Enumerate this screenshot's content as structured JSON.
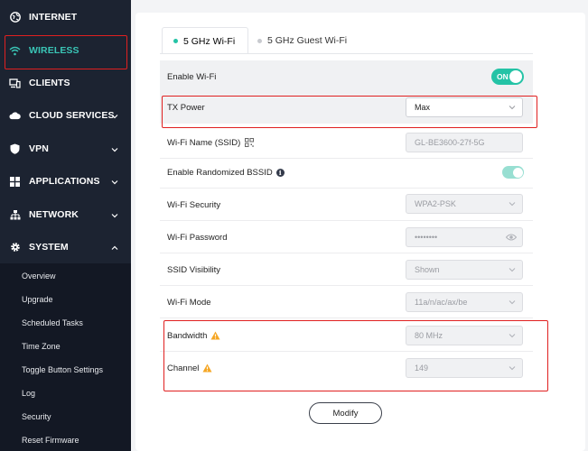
{
  "sidebar": {
    "items": [
      {
        "label": "INTERNET",
        "icon": "globe-icon"
      },
      {
        "label": "WIRELESS",
        "icon": "wifi-icon"
      },
      {
        "label": "CLIENTS",
        "icon": "devices-icon"
      },
      {
        "label": "CLOUD SERVICES",
        "icon": "cloud-icon"
      },
      {
        "label": "VPN",
        "icon": "shield-icon"
      },
      {
        "label": "APPLICATIONS",
        "icon": "grid-icon"
      },
      {
        "label": "NETWORK",
        "icon": "network-icon"
      },
      {
        "label": "SYSTEM",
        "icon": "gear-icon"
      }
    ],
    "system_submenu": [
      "Overview",
      "Upgrade",
      "Scheduled Tasks",
      "Time Zone",
      "Toggle Button Settings",
      "Log",
      "Security",
      "Reset Firmware"
    ]
  },
  "tabs": [
    {
      "label": "5 GHz Wi-Fi",
      "active": true
    },
    {
      "label": "5 GHz Guest Wi-Fi",
      "active": false
    }
  ],
  "settings": {
    "enable_wifi": {
      "label": "Enable Wi-Fi",
      "toggle": "ON"
    },
    "tx_power": {
      "label": "TX Power",
      "value": "Max"
    },
    "ssid": {
      "label": "Wi-Fi Name (SSID)",
      "value": "GL-BE3600-27f-5G"
    },
    "randomized_bssid": {
      "label": "Enable Randomized BSSID"
    },
    "security": {
      "label": "Wi-Fi Security",
      "value": "WPA2-PSK"
    },
    "password": {
      "label": "Wi-Fi Password",
      "value": "••••••••"
    },
    "ssid_visibility": {
      "label": "SSID Visibility",
      "value": "Shown"
    },
    "wifi_mode": {
      "label": "Wi-Fi Mode",
      "value": "11a/n/ac/ax/be"
    },
    "bandwidth": {
      "label": "Bandwidth",
      "value": "80 MHz"
    },
    "channel": {
      "label": "Channel",
      "value": "149"
    }
  },
  "modify_label": "Modify",
  "colors": {
    "accent": "#24c3a6",
    "sidebar": "#1c2331",
    "highlight": "#e02020",
    "warning": "#f5a623"
  }
}
